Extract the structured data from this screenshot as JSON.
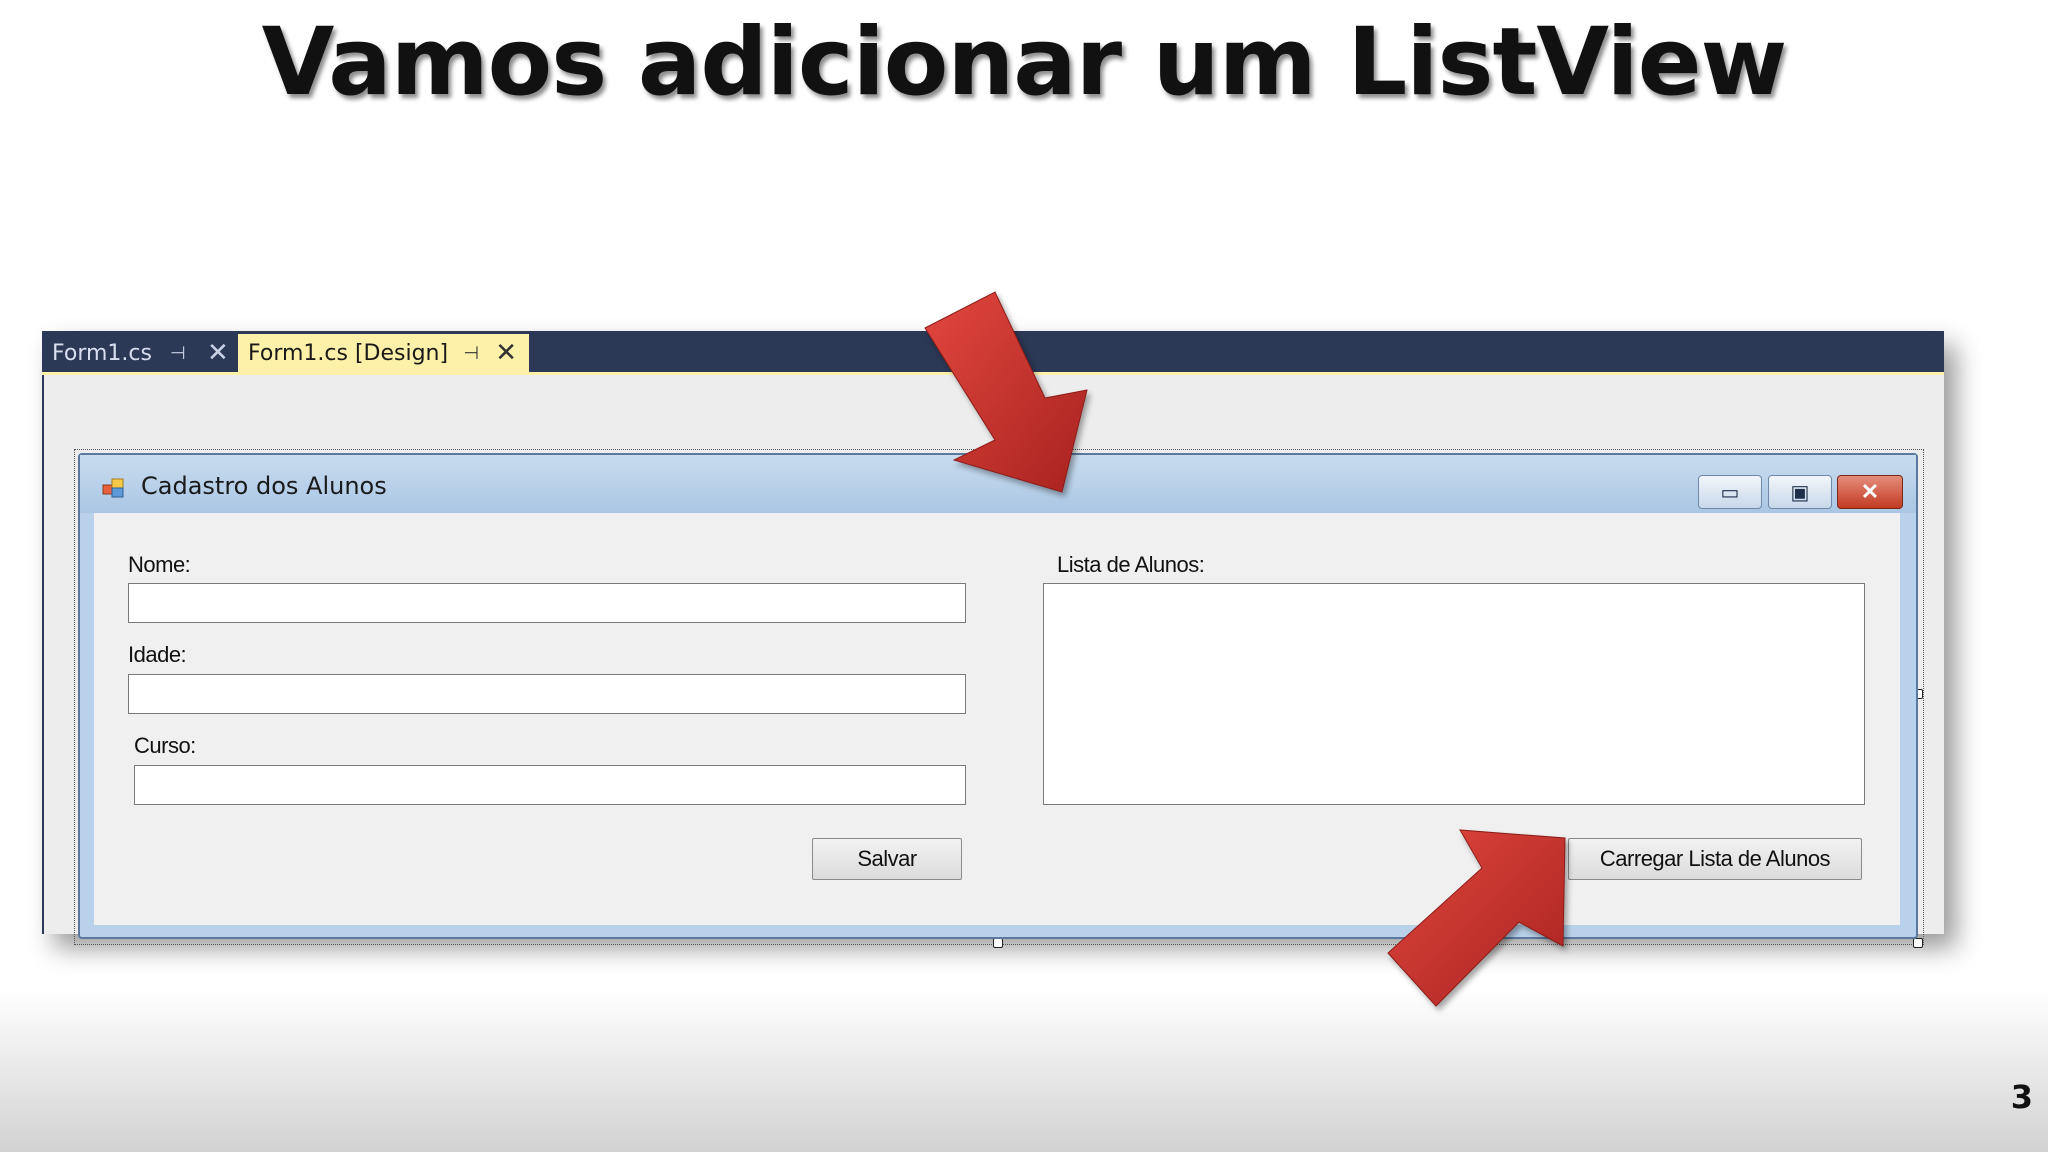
{
  "slide": {
    "title": "Vamos adicionar um ListView",
    "page_number": "3"
  },
  "editor": {
    "tabs": [
      {
        "label": "Form1.cs",
        "pin_icon": "pin-icon",
        "close_icon": "close-icon",
        "active": false
      },
      {
        "label": "Form1.cs [Design]",
        "pin_icon": "pin-icon",
        "close_icon": "close-icon",
        "active": true
      }
    ],
    "pin_glyph": "⊣",
    "close_glyph": "✕"
  },
  "form": {
    "title": "Cadastro dos Alunos",
    "caption_buttons": {
      "minimize": "▭",
      "maximize": "▣",
      "close": "✕"
    },
    "fields": [
      {
        "label": "Nome:",
        "value": ""
      },
      {
        "label": "Idade:",
        "value": ""
      },
      {
        "label": "Curso:",
        "value": ""
      }
    ],
    "list_label": "Lista de Alunos:",
    "save_button": "Salvar",
    "load_button": "Carregar Lista de Alunos"
  },
  "colors": {
    "tabstrip": "#2c3956",
    "active_tab": "#fdf0a8",
    "arrow": "#c0302c"
  }
}
